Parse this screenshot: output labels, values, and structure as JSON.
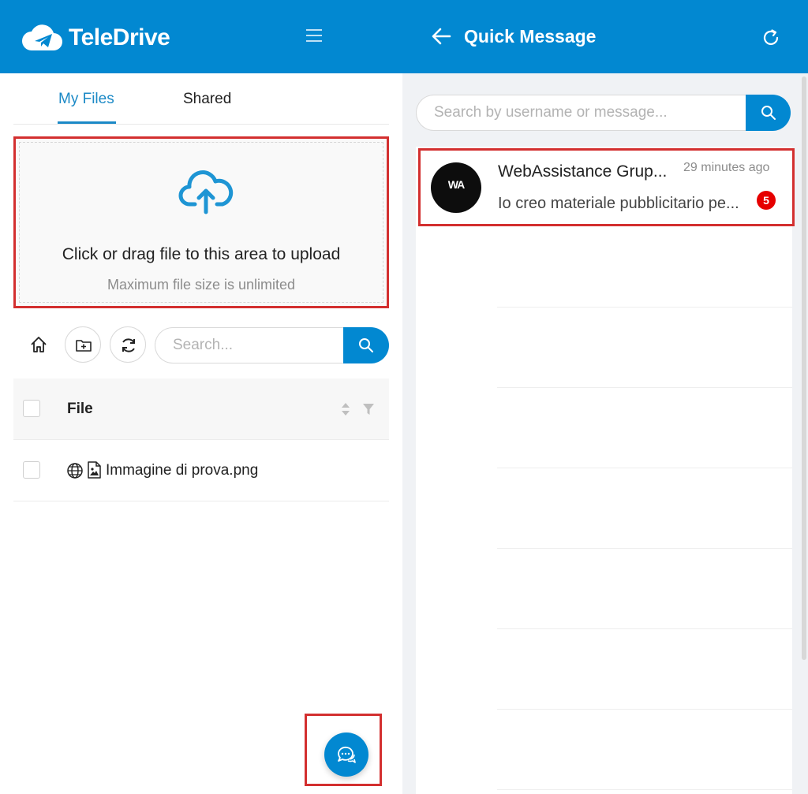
{
  "brand": {
    "name": "TeleDrive",
    "color": "#0288d1"
  },
  "tabs": [
    {
      "label": "My Files",
      "active": true
    },
    {
      "label": "Shared",
      "active": false
    }
  ],
  "upload": {
    "text": "Click or drag file to this area to upload",
    "hint": "Maximum file size is unlimited",
    "icon": "cloud-upload-icon"
  },
  "toolbar": {
    "search_placeholder": "Search...",
    "icons": [
      "home-icon",
      "new-folder-icon",
      "refresh-icon",
      "search-icon"
    ]
  },
  "table": {
    "header": {
      "file": "File"
    },
    "rows": [
      {
        "name": "Immagine di prova.png",
        "icons": [
          "globe-icon",
          "image-file-icon"
        ]
      }
    ]
  },
  "quick_message": {
    "title": "Quick Message",
    "search_placeholder": "Search by username or message...",
    "conversations": [
      {
        "avatar_text": "WA",
        "name": "WebAssistance Grup...",
        "time": "29 minutes ago",
        "preview": "Io creo materiale pubblicitario pe...",
        "unread": "5"
      }
    ]
  },
  "colors": {
    "accent": "#0288d1",
    "highlight": "#d32f2f",
    "badge": "#e60000"
  }
}
